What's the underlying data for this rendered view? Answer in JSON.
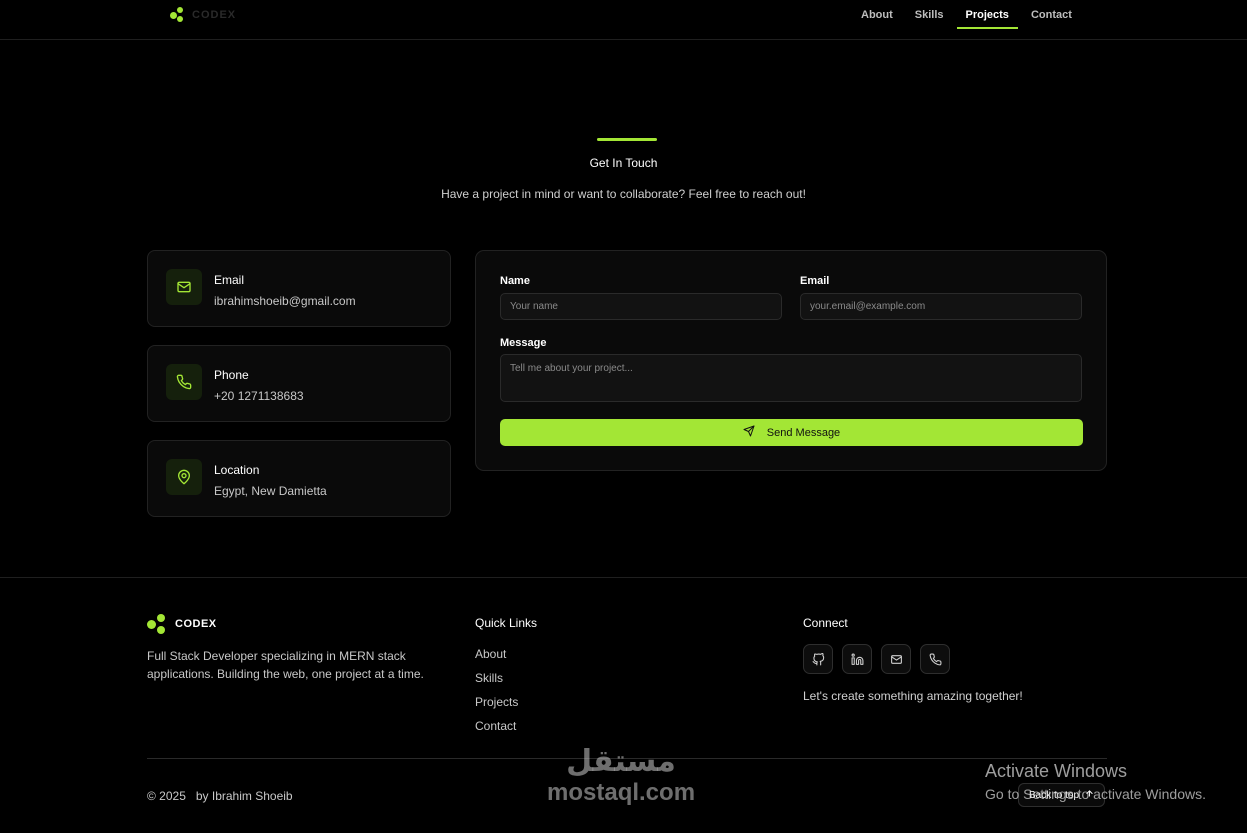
{
  "colors": {
    "accent": "#a3e635",
    "background": "#000000",
    "card": "#0a0a0a"
  },
  "nav": {
    "logo_text": "CODEX",
    "links": [
      {
        "label": "About"
      },
      {
        "label": "Skills"
      },
      {
        "label": "Projects",
        "active": true
      },
      {
        "label": "Contact"
      }
    ]
  },
  "contact": {
    "title": "Get In Touch",
    "subtitle": "Have a project in mind or want to collaborate? Feel free to reach out!",
    "cards": [
      {
        "icon": "mail-icon",
        "label": "Email",
        "value": "ibrahimshoeib@gmail.com"
      },
      {
        "icon": "phone-icon",
        "label": "Phone",
        "value": "+20 1271138683"
      },
      {
        "icon": "location-pin-icon",
        "label": "Location",
        "value": "Egypt, New Damietta"
      }
    ],
    "form": {
      "name_label": "Name",
      "name_placeholder": "Your name",
      "email_label": "Email",
      "email_placeholder": "your.email@example.com",
      "message_label": "Message",
      "message_placeholder": "Tell me about your project...",
      "send_label": "Send Message"
    }
  },
  "footer": {
    "logo_text": "CODEX",
    "description": "Full Stack Developer specializing in MERN stack applications. Building the web, one project at a time.",
    "quick_links_title": "Quick Links",
    "quick_links": [
      "About",
      "Skills",
      "Projects",
      "Contact"
    ],
    "connect_title": "Connect",
    "social_icons": [
      "github-icon",
      "linkedin-icon",
      "mail-icon",
      "phone-icon"
    ],
    "tagline": "Let's create something amazing together!",
    "copyright": "© 2025",
    "author": "by Ibrahim Shoeib",
    "back_to_top": "Back to top"
  },
  "watermark": {
    "arabic": "مستقل",
    "latin": "mostaql.com"
  },
  "windows_activation": {
    "title": "Activate Windows",
    "subtitle": "Go to Settings to activate Windows."
  }
}
